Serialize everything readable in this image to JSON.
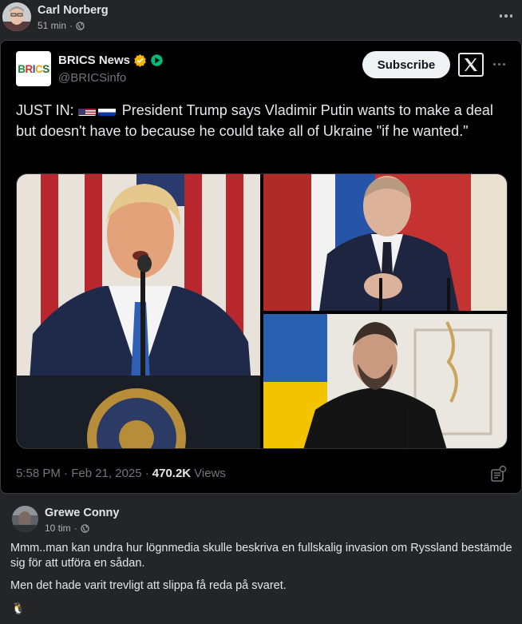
{
  "post": {
    "author": "Carl Norberg",
    "time": "51 min",
    "separator": "·",
    "privacy_icon": "globe-icon"
  },
  "embed": {
    "account_name": "BRICS News",
    "account_handle": "@BRICSinfo",
    "logo_text": "BRICS",
    "subscribe_label": "Subscribe",
    "tweet_prefix": "JUST IN:",
    "tweet_body": "President Trump says Vladimir Putin wants to make a deal but doesn't have to because he could take all of Ukraine \"if he wanted.\"",
    "timestamp": "5:58 PM · Feb 21, 2025 ·",
    "views_count": "470.2K",
    "views_label": "Views",
    "colors": {
      "subscribe_bg": "#eff3f4",
      "verified_gold": "#f4b400",
      "verified_green": "#00ba7c"
    }
  },
  "comment": {
    "author": "Grewe Conny",
    "time": "10 tim",
    "separator": "·",
    "paragraph1": "Mmm..man kan undra hur lögnmedia skulle beskriva en fullskalig invasion om Ryssland bestämde sig för att utföra en sådan.",
    "paragraph2": "Men det hade varit trevligt att slippa få reda på svaret.",
    "emoji": "🐧"
  }
}
